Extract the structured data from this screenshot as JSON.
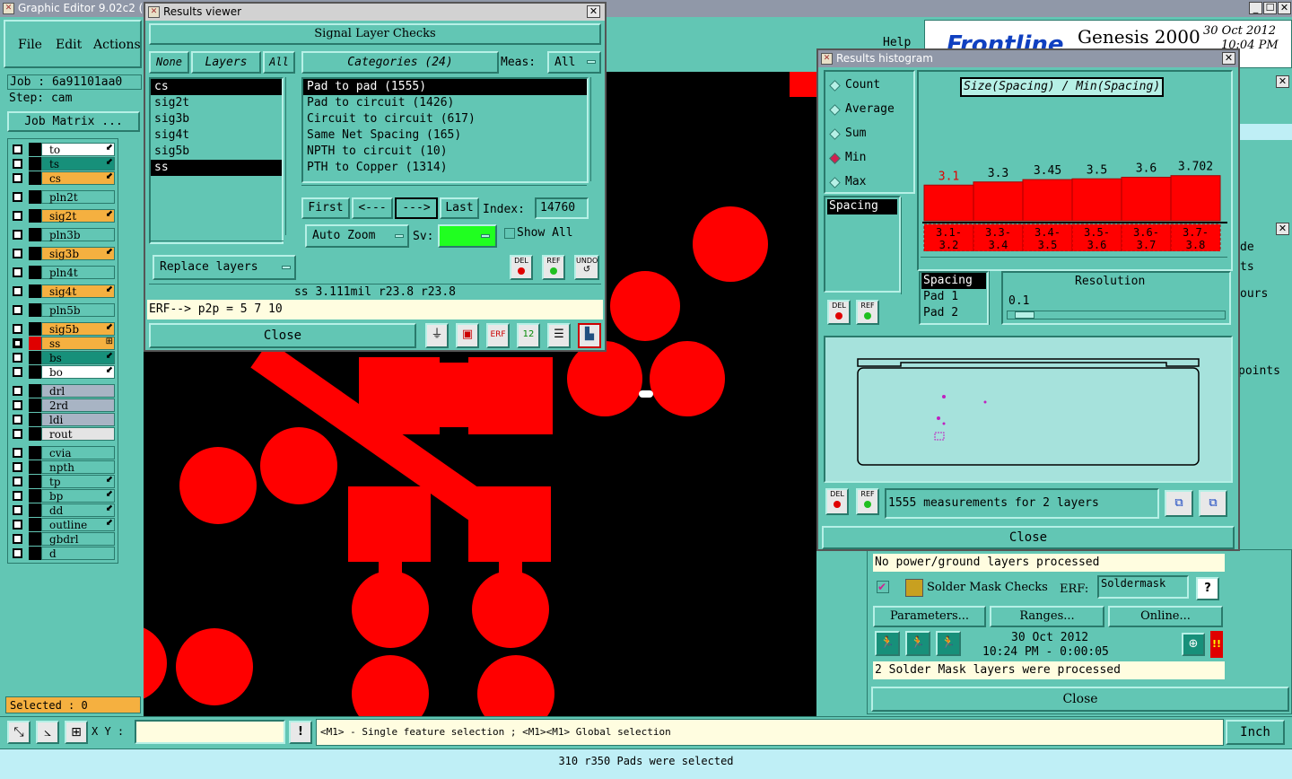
{
  "main_window": {
    "title": "Graphic Editor 9.02c2 (0",
    "menu": [
      "File",
      "Edit",
      "Actions"
    ],
    "job_label": "Job : 6a91101aa0",
    "step_label": "Step: cam",
    "job_matrix_button": "Job Matrix ...",
    "help_label": "Help",
    "selected_label": "Selected : 0",
    "xy_label": "X Y :",
    "xy_value": "",
    "hint_text": "<M1> - Single feature selection ; <M1><M1> Global selection",
    "units": "Inch",
    "status_bar": "310 r350 Pads were selected",
    "window_controls": [
      "_",
      "☐",
      "✕"
    ]
  },
  "layers": [
    {
      "name": "to",
      "color": "#ffffff",
      "mark": "⬋",
      "state": "empty"
    },
    {
      "name": "ts",
      "color": "#17907a",
      "mark": "⬋",
      "state": "empty"
    },
    {
      "name": "cs",
      "color": "#f5b040",
      "mark": "⬋",
      "state": "empty"
    },
    {
      "name": "pln2t",
      "color": "#62c6b4",
      "mark": "",
      "state": "empty"
    },
    {
      "name": "sig2t",
      "color": "#f5b040",
      "mark": "⬋",
      "state": "empty"
    },
    {
      "name": "pln3b",
      "color": "#62c6b4",
      "mark": "",
      "state": "empty"
    },
    {
      "name": "sig3b",
      "color": "#f5b040",
      "mark": "⬋",
      "state": "empty"
    },
    {
      "name": "pln4t",
      "color": "#62c6b4",
      "mark": "",
      "state": "empty"
    },
    {
      "name": "sig4t",
      "color": "#f5b040",
      "mark": "⬋",
      "state": "empty"
    },
    {
      "name": "pln5b",
      "color": "#62c6b4",
      "mark": "",
      "state": "empty"
    },
    {
      "name": "sig5b",
      "color": "#f5b040",
      "mark": "⬋",
      "state": "empty"
    },
    {
      "name": "ss",
      "color": "#f5b040",
      "mark": "⊞",
      "state": "filled"
    },
    {
      "name": "bs",
      "color": "#17907a",
      "mark": "⬋",
      "state": "empty"
    },
    {
      "name": "bo",
      "color": "#ffffff",
      "mark": "⬋",
      "state": "empty"
    },
    {
      "name": "drl",
      "color": "#a8b4c4",
      "mark": "",
      "state": "empty"
    },
    {
      "name": "2rd",
      "color": "#a8b4c4",
      "mark": "",
      "state": "empty"
    },
    {
      "name": "ldi",
      "color": "#a8b4c4",
      "mark": "",
      "state": "empty"
    },
    {
      "name": "rout",
      "color": "#e4e4e4",
      "mark": "",
      "state": "empty"
    },
    {
      "name": "cvia",
      "color": "#62c6b4",
      "mark": "",
      "state": "empty"
    },
    {
      "name": "npth",
      "color": "#62c6b4",
      "mark": "",
      "state": "empty"
    },
    {
      "name": "tp",
      "color": "#62c6b4",
      "mark": "⬋",
      "state": "empty"
    },
    {
      "name": "bp",
      "color": "#62c6b4",
      "mark": "⬋",
      "state": "empty"
    },
    {
      "name": "dd",
      "color": "#62c6b4",
      "mark": "⬋",
      "state": "empty"
    },
    {
      "name": "outline",
      "color": "#62c6b4",
      "mark": "⬋",
      "state": "empty"
    },
    {
      "name": "gbdrl",
      "color": "#62c6b4",
      "mark": "",
      "state": "empty"
    },
    {
      "name": "d",
      "color": "#62c6b4",
      "mark": "",
      "state": "empty"
    }
  ],
  "results_viewer": {
    "title": "Results viewer",
    "close_x": "✕",
    "header": "Signal Layer Checks",
    "none_btn": "None",
    "layers_btn": "Layers",
    "all_btn": "All",
    "categories_btn": "Categories (24)",
    "meas_label": "Meas:",
    "meas_value": "All",
    "layer_list": [
      "cs",
      "sig2t",
      "sig3b",
      "sig4t",
      "sig5b",
      "ss"
    ],
    "category_list": [
      "Pad to pad (1555)",
      "Pad to circuit (1426)",
      "Circuit to circuit (617)",
      "Same Net Spacing (165)",
      "NPTH to circuit (10)",
      "PTH to Copper (1314)"
    ],
    "first_btn": "First",
    "prev_btn": "<---",
    "next_btn": "--->",
    "last_btn": "Last",
    "index_label": "Index:",
    "index_value": "14760",
    "auto_zoom": "Auto Zoom",
    "sv_label": "Sv:",
    "show_all": "Show All",
    "del_btn": "DEL",
    "ref_btn": "REF",
    "undo_btn": "UNDO",
    "replace_layers": "Replace layers",
    "measure_text": "ss 3.111mil  r23.8  r23.8",
    "erf_text": "ERF--> p2p = 5 7 10",
    "close_btn": "Close"
  },
  "histogram": {
    "title": "Results histogram",
    "close_x": "✕",
    "modes": [
      "Count",
      "Average",
      "Sum",
      "Min",
      "Max"
    ],
    "selected_mode": "Min",
    "chart_title": "Size(Spacing) / Min(Spacing)",
    "bar_values": [
      "3.1",
      "3.3",
      "3.45",
      "3.5",
      "3.6",
      "3.702"
    ],
    "bar_ranges": [
      [
        "3.1-",
        "3.2"
      ],
      [
        "3.3-",
        "3.4"
      ],
      [
        "3.4-",
        "3.5"
      ],
      [
        "3.5-",
        "3.6"
      ],
      [
        "3.6-",
        "3.7"
      ],
      [
        "3.7-",
        "3.8"
      ]
    ],
    "measure_list": [
      "Spacing"
    ],
    "field_list": [
      "Spacing",
      "Pad 1",
      "Pad 2"
    ],
    "resolution_label": "Resolution",
    "resolution_value": "0.1",
    "del_btn": "DEL",
    "ref_btn": "REF",
    "summary": "1555 measurements for 2 layers",
    "close_btn": "Close"
  },
  "solder_panel": {
    "no_power": "No power/ground layers processed",
    "title": "Solder Mask Checks",
    "erf_label": "ERF:",
    "erf_value": "Soldermask",
    "help_q": "?",
    "parameters_btn": "Parameters...",
    "ranges_btn": "Ranges...",
    "online_btn": "Online...",
    "date": "30 Oct 2012",
    "time": "10:24 PM - 0:00:05",
    "status": "2 Solder Mask layers were processed",
    "close_btn": "Close",
    "alert": "!!"
  },
  "genesis": {
    "brand": "Frontline",
    "product": "Genesis 2000",
    "date": "30 Oct 2012",
    "time": "10:04 PM"
  },
  "right_partial": {
    "items": [
      "de",
      "ts",
      "ours",
      "points"
    ]
  },
  "chart_data": {
    "type": "bar",
    "title": "Size(Spacing) / Min(Spacing)",
    "categories": [
      "3.1-3.2",
      "3.3-3.4",
      "3.4-3.5",
      "3.5-3.6",
      "3.6-3.7",
      "3.7-3.8"
    ],
    "values": [
      3.1,
      3.3,
      3.45,
      3.5,
      3.6,
      3.702
    ],
    "xlabel": "",
    "ylabel": ""
  }
}
